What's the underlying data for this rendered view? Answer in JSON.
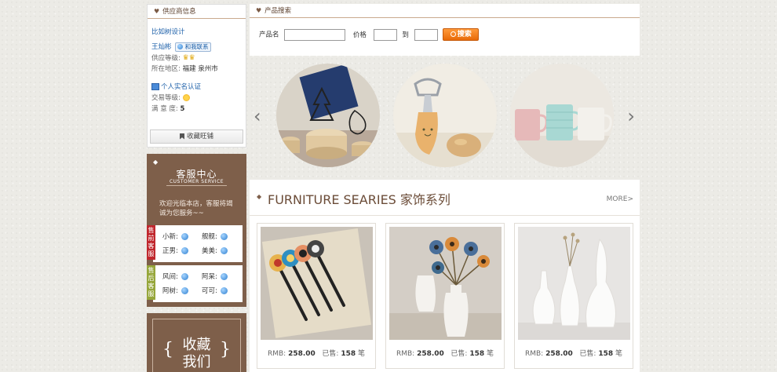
{
  "supplier": {
    "header": "供应商信息",
    "shop_name": "比如树设计",
    "contact_name": "王灿彬",
    "talk_button": "和我联系",
    "supply_level_label": "供应等级:",
    "region_label": "所在地区:",
    "region_value": "福建 泉州市",
    "verify_label": "个人实名认证",
    "trade_level_label": "交易等级:",
    "satisfaction_label": "满 意 度:",
    "satisfaction_value": "5",
    "fav_shop_button": "收藏旺铺"
  },
  "customer_service": {
    "title": "客服中心",
    "subtitle": "CUSTOMER SERVICE",
    "welcome": "欢迎光临本店，客服将竭诚为您服务~~",
    "pre_sale_tag": "售前客服",
    "post_sale_tag": "售后客服",
    "pre_sale_agents": [
      "小新:",
      "舰舰:",
      "正男:",
      "美美:"
    ],
    "post_sale_agents": [
      "风间:",
      "阿呆:",
      "阿树:",
      "可可:"
    ]
  },
  "collect": {
    "line1": "收藏",
    "line2": "我们"
  },
  "search": {
    "header": "产品搜索",
    "name_label": "产品名",
    "price_label": "价格",
    "to_label": "到",
    "button": "搜索",
    "name_value": "",
    "price_min": "",
    "price_max": ""
  },
  "carousel": {
    "prev": "‹",
    "next": "›"
  },
  "series": {
    "title": "FURNITURE SEARIES 家饰系列",
    "more": "MORE>",
    "products": [
      {
        "price_label": "RMB:",
        "price": "258.00",
        "sold_label": "已售:",
        "sold": "158",
        "unit": "笔"
      },
      {
        "price_label": "RMB:",
        "price": "258.00",
        "sold_label": "已售:",
        "sold": "158",
        "unit": "笔"
      },
      {
        "price_label": "RMB:",
        "price": "258.00",
        "sold_label": "已售:",
        "sold": "158",
        "unit": "笔"
      }
    ]
  }
}
